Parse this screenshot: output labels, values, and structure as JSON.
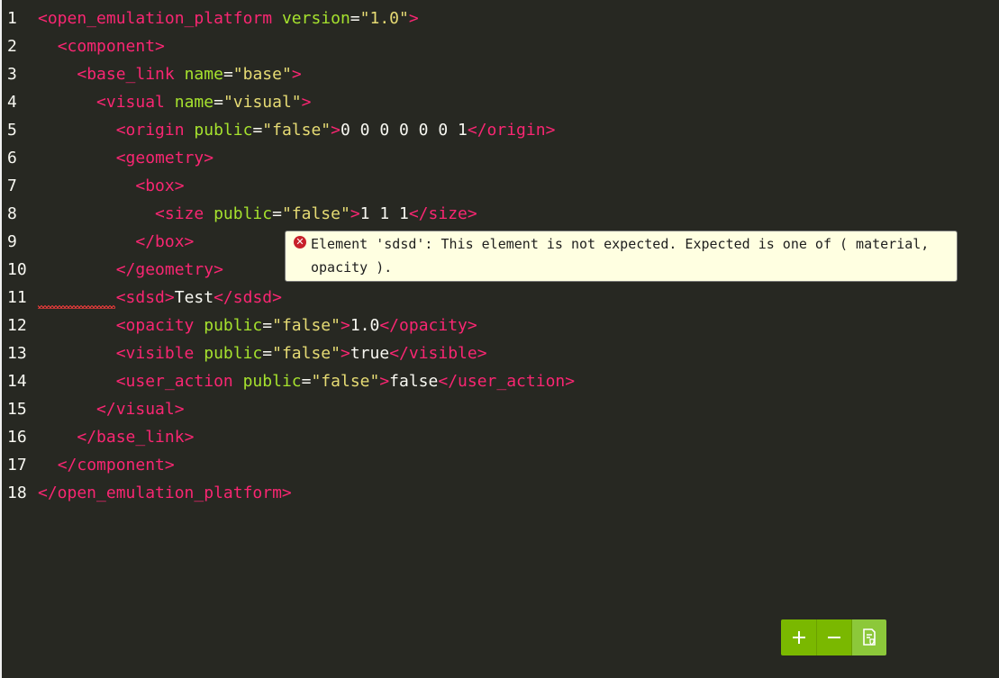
{
  "editor": {
    "lines": [
      {
        "n": "1",
        "indent": "",
        "parts": [
          [
            "tag",
            "<open_emulation_platform "
          ],
          [
            "attr",
            "version"
          ],
          [
            "op",
            "="
          ],
          [
            "str",
            "\"1.0\""
          ],
          [
            "tag",
            ">"
          ]
        ]
      },
      {
        "n": "2",
        "indent": "  ",
        "parts": [
          [
            "tag",
            "<component>"
          ]
        ]
      },
      {
        "n": "3",
        "indent": "    ",
        "parts": [
          [
            "tag",
            "<base_link "
          ],
          [
            "attr",
            "name"
          ],
          [
            "op",
            "="
          ],
          [
            "str",
            "\"base\""
          ],
          [
            "tag",
            ">"
          ]
        ]
      },
      {
        "n": "4",
        "indent": "      ",
        "parts": [
          [
            "tag",
            "<visual "
          ],
          [
            "attr",
            "name"
          ],
          [
            "op",
            "="
          ],
          [
            "str",
            "\"visual\""
          ],
          [
            "tag",
            ">"
          ]
        ]
      },
      {
        "n": "5",
        "indent": "        ",
        "parts": [
          [
            "tag",
            "<origin "
          ],
          [
            "attr",
            "public"
          ],
          [
            "op",
            "="
          ],
          [
            "str",
            "\"false\""
          ],
          [
            "tag",
            ">"
          ],
          [
            "txt",
            "0 0 0 0 0 0 1"
          ],
          [
            "tag",
            "</origin>"
          ]
        ]
      },
      {
        "n": "6",
        "indent": "        ",
        "parts": [
          [
            "tag",
            "<geometry>"
          ]
        ]
      },
      {
        "n": "7",
        "indent": "          ",
        "parts": [
          [
            "tag",
            "<box>"
          ]
        ]
      },
      {
        "n": "8",
        "indent": "            ",
        "parts": [
          [
            "tag",
            "<size "
          ],
          [
            "attr",
            "public"
          ],
          [
            "op",
            "="
          ],
          [
            "str",
            "\"false\""
          ],
          [
            "tag",
            ">"
          ],
          [
            "txt",
            "1 1 1"
          ],
          [
            "tag",
            "</size>"
          ]
        ]
      },
      {
        "n": "9",
        "indent": "          ",
        "parts": [
          [
            "tag",
            "</box>"
          ]
        ]
      },
      {
        "n": "10",
        "indent": "        ",
        "parts": [
          [
            "tag",
            "</geometry>"
          ]
        ]
      },
      {
        "n": "11",
        "indent": "        ",
        "parts": [
          [
            "tag",
            "<sdsd>"
          ],
          [
            "txt",
            "Test"
          ],
          [
            "tag",
            "</sdsd>"
          ]
        ]
      },
      {
        "n": "12",
        "indent": "        ",
        "parts": [
          [
            "tag",
            "<opacity "
          ],
          [
            "attr",
            "public"
          ],
          [
            "op",
            "="
          ],
          [
            "str",
            "\"false\""
          ],
          [
            "tag",
            ">"
          ],
          [
            "txt",
            "1.0"
          ],
          [
            "tag",
            "</opacity>"
          ]
        ]
      },
      {
        "n": "13",
        "indent": "        ",
        "parts": [
          [
            "tag",
            "<visible "
          ],
          [
            "attr",
            "public"
          ],
          [
            "op",
            "="
          ],
          [
            "str",
            "\"false\""
          ],
          [
            "tag",
            ">"
          ],
          [
            "txt",
            "true"
          ],
          [
            "tag",
            "</visible>"
          ]
        ]
      },
      {
        "n": "14",
        "indent": "        ",
        "parts": [
          [
            "tag",
            "<user_action "
          ],
          [
            "attr",
            "public"
          ],
          [
            "op",
            "="
          ],
          [
            "str",
            "\"false\""
          ],
          [
            "tag",
            ">"
          ],
          [
            "txt",
            "false"
          ],
          [
            "tag",
            "</user_action>"
          ]
        ]
      },
      {
        "n": "15",
        "indent": "      ",
        "parts": [
          [
            "tag",
            "</visual>"
          ]
        ]
      },
      {
        "n": "16",
        "indent": "    ",
        "parts": [
          [
            "tag",
            "</base_link>"
          ]
        ]
      },
      {
        "n": "17",
        "indent": "  ",
        "parts": [
          [
            "tag",
            "</component>"
          ]
        ]
      },
      {
        "n": "18",
        "indent": "",
        "parts": [
          [
            "tag",
            "</open_emulation_platform>"
          ]
        ]
      }
    ]
  },
  "tooltip": {
    "icon": "error-icon",
    "line1": "Element 'sdsd': This element is not expected. Expected is one of ( material,",
    "line2": "opacity )."
  },
  "toolbar": {
    "buttons": [
      {
        "icon": "plus-icon"
      },
      {
        "icon": "minus-icon"
      },
      {
        "icon": "validate-document-icon"
      }
    ]
  },
  "colors": {
    "background": "#272822",
    "tag": "#f92672",
    "attribute": "#a6e22e",
    "string": "#e6db74",
    "text": "#f8f8f2",
    "toolbar": "#7ab800",
    "error": "#c8202a",
    "tooltip_bg": "#ffffe1"
  }
}
